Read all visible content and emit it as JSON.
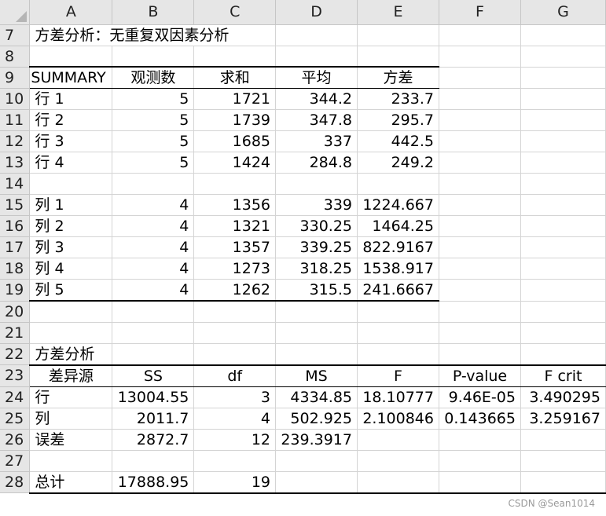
{
  "columns": [
    "A",
    "B",
    "C",
    "D",
    "E",
    "F",
    "G"
  ],
  "title": "方差分析：无重复双因素分析",
  "summary": {
    "headers": [
      "SUMMARY",
      "观测数",
      "求和",
      "平均",
      "方差"
    ],
    "rows": [
      {
        "row": "10",
        "label": "行 1",
        "count": "5",
        "sum": "1721",
        "avg": "344.2",
        "var": "233.7"
      },
      {
        "row": "11",
        "label": "行 2",
        "count": "5",
        "sum": "1739",
        "avg": "347.8",
        "var": "295.7"
      },
      {
        "row": "12",
        "label": "行 3",
        "count": "5",
        "sum": "1685",
        "avg": "337",
        "var": "442.5"
      },
      {
        "row": "13",
        "label": "行 4",
        "count": "5",
        "sum": "1424",
        "avg": "284.8",
        "var": "249.2"
      }
    ],
    "cols": [
      {
        "row": "15",
        "label": "列 1",
        "count": "4",
        "sum": "1356",
        "avg": "339",
        "var": "1224.667"
      },
      {
        "row": "16",
        "label": "列 2",
        "count": "4",
        "sum": "1321",
        "avg": "330.25",
        "var": "1464.25"
      },
      {
        "row": "17",
        "label": "列 3",
        "count": "4",
        "sum": "1357",
        "avg": "339.25",
        "var": "822.9167"
      },
      {
        "row": "18",
        "label": "列 4",
        "count": "4",
        "sum": "1273",
        "avg": "318.25",
        "var": "1538.917"
      },
      {
        "row": "19",
        "label": "列 5",
        "count": "4",
        "sum": "1262",
        "avg": "315.5",
        "var": "241.6667"
      }
    ]
  },
  "anova": {
    "title": "方差分析",
    "headers": [
      "差异源",
      "SS",
      "df",
      "MS",
      "F",
      "P-value",
      "F crit"
    ],
    "rows": [
      {
        "row": "24",
        "source": "行",
        "ss": "13004.55",
        "df": "3",
        "ms": "4334.85",
        "f": "18.10777",
        "p": "9.46E-05",
        "fcrit": "3.490295"
      },
      {
        "row": "25",
        "source": "列",
        "ss": "2011.7",
        "df": "4",
        "ms": "502.925",
        "f": "2.100846",
        "p": "0.143665",
        "fcrit": "3.259167"
      },
      {
        "row": "26",
        "source": "误差",
        "ss": "2872.7",
        "df": "12",
        "ms": "239.3917",
        "f": "",
        "p": "",
        "fcrit": ""
      }
    ],
    "total": {
      "row": "28",
      "source": "总计",
      "ss": "17888.95",
      "df": "19"
    }
  },
  "row_numbers": {
    "title": "7",
    "r8": "8",
    "r9": "9",
    "r14": "14",
    "r20": "20",
    "r21": "21",
    "r22": "22",
    "r23": "23",
    "r27": "27"
  },
  "watermark": "CSDN @Sean1014"
}
